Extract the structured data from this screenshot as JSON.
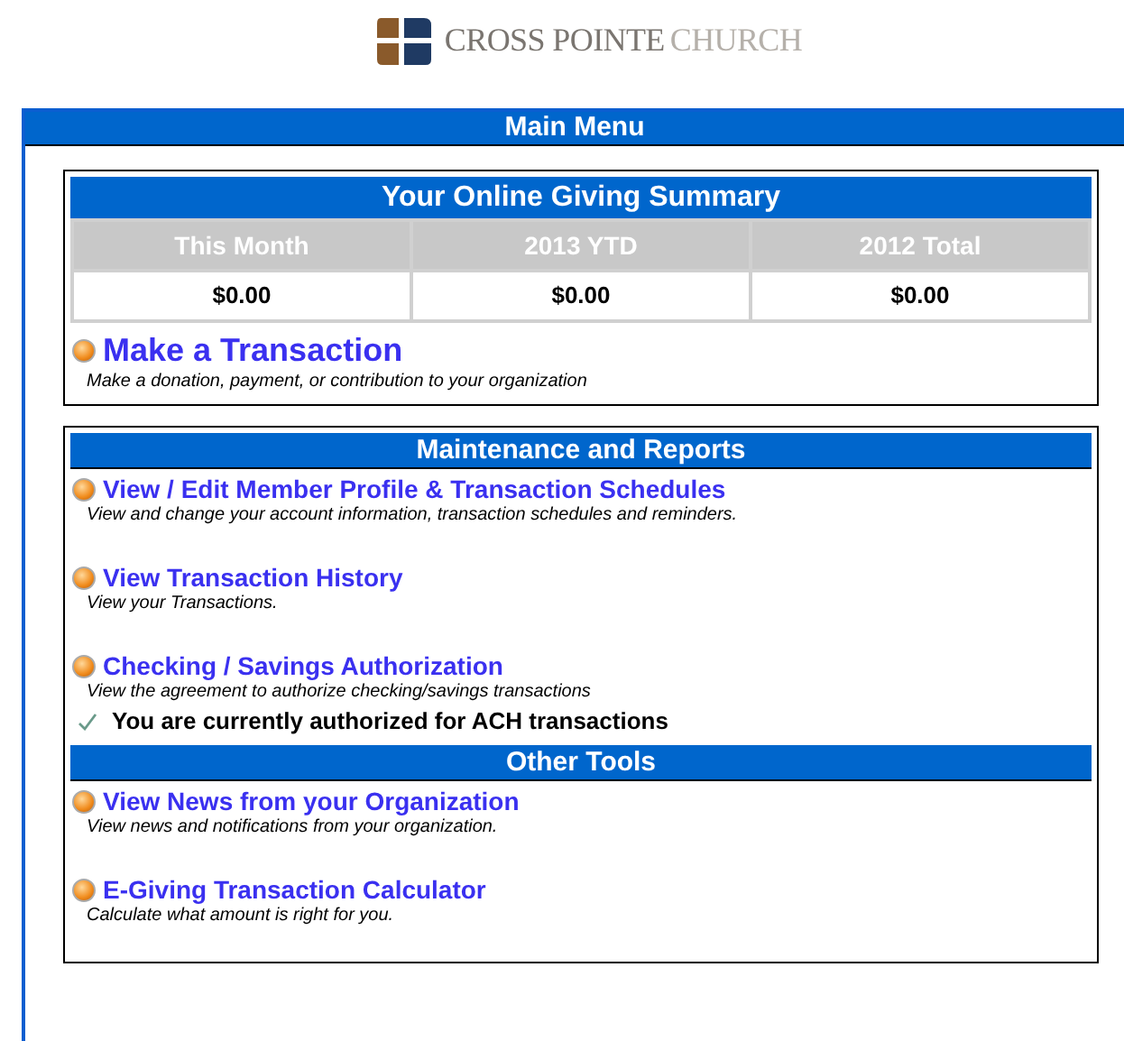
{
  "logo": {
    "name_dark": "CROSS POINTE",
    "name_light": "CHURCH"
  },
  "main_menu": {
    "title": "Main Menu",
    "summary": {
      "title": "Your Online Giving Summary",
      "columns": [
        "This Month",
        "2013 YTD",
        "2012 Total"
      ],
      "values": [
        "$0.00",
        "$0.00",
        "$0.00"
      ]
    },
    "primary_action": {
      "link": "Make a Transaction",
      "description": "Make a donation, payment, or contribution to your organization"
    },
    "sections": [
      {
        "title": "Maintenance and Reports",
        "items": [
          {
            "link": "View / Edit Member Profile & Transaction Schedules",
            "description": "View and change your account information, transaction schedules and reminders."
          },
          {
            "link": "View Transaction History",
            "description": "View your Transactions."
          },
          {
            "link": "Checking / Savings Authorization",
            "description": "View the agreement to authorize checking/savings transactions",
            "status": "You are currently authorized for ACH transactions"
          }
        ]
      },
      {
        "title": "Other Tools",
        "items": [
          {
            "link": "View News from your Organization",
            "description": "View news and notifications from your organization."
          },
          {
            "link": "E-Giving Transaction Calculator",
            "description": "Calculate what amount is right for you."
          }
        ]
      }
    ]
  }
}
